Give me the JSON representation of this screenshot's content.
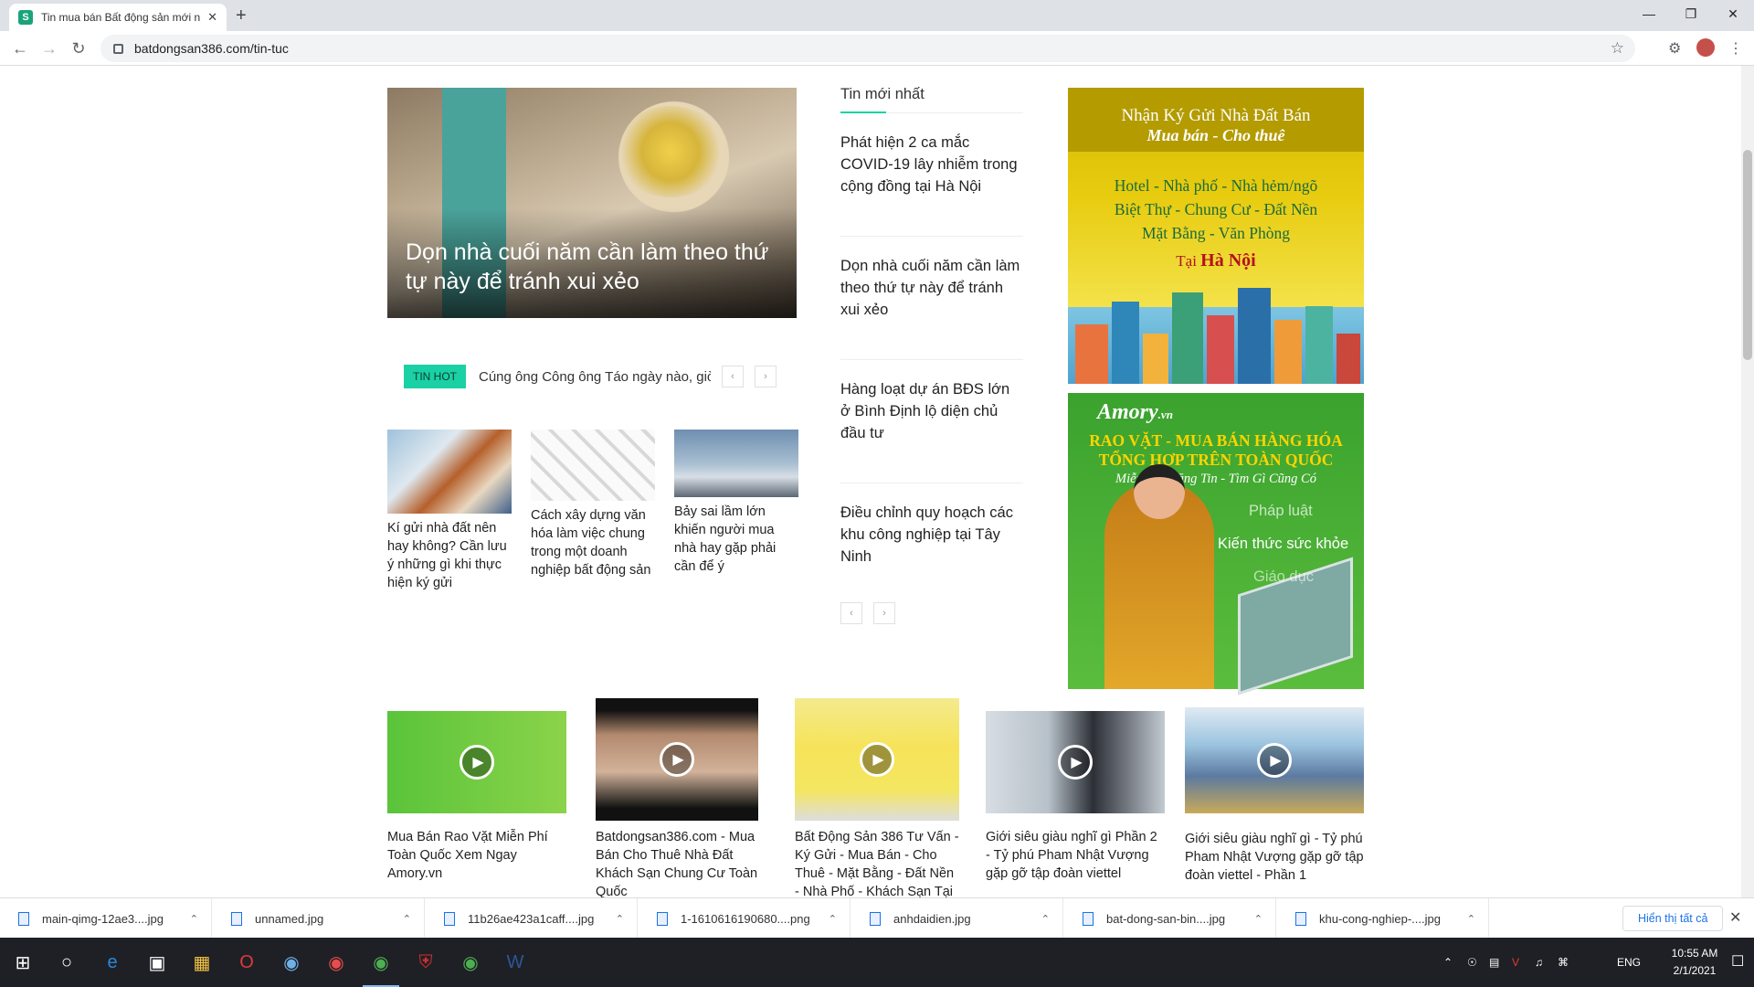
{
  "browser": {
    "tab_title": "Tin mua bán Bất động sản mới nhất",
    "url": "batdongsan386.com/tin-tuc",
    "new_tab": "+",
    "close_tab": "✕"
  },
  "hero": {
    "title": "Dọn nhà cuối năm cần làm theo thứ tự này để tránh xui xẻo"
  },
  "ticker": {
    "badge": "TIN HOT",
    "text": "Cúng ông Công ông Táo ngày nào, giờ nào tốt nhất"
  },
  "mini_articles": [
    {
      "caption": "Kí gửi nhà đất nên hay không? Cần lưu ý những gì khi thực hiện ký gửi"
    },
    {
      "caption": "Cách xây dựng văn hóa làm việc chung trong một doanh nghiệp bất động sản"
    },
    {
      "caption": "Bảy sai lầm lớn khiến người mua nhà hay gặp phải cần để ý"
    }
  ],
  "latest": {
    "heading": "Tin mới nhất",
    "items": [
      "Phát hiện 2 ca mắc COVID-19 lây nhiễm trong cộng đồng tại Hà Nội",
      "Dọn nhà cuối năm cần làm theo thứ tự này để tránh xui xẻo",
      "Hàng loạt dự án BĐS lớn ở Bình Định lộ diện chủ đầu tư",
      "Điều chỉnh quy hoạch các khu công nghiệp tại Tây Ninh"
    ]
  },
  "ad_kygui": {
    "line1": "Nhận Ký Gửi Nhà Đất Bán",
    "line2": "Mua bán - Cho thuê",
    "line3": "Hotel - Nhà phố - Nhà hẻm/ngõ",
    "line4": "Biệt Thự - Chung Cư - Đất Nền",
    "line5": "Mặt Bằng - Văn Phòng",
    "line6_prefix": "Tại",
    "line6_city": "Hà Nội"
  },
  "ad_amory": {
    "logo": "Amory",
    "logo_suffix": ".vn",
    "headline1": "RAO VẶT - MUA BÁN HÀNG HÓA",
    "headline2": "TỔNG HỢP TRÊN TOÀN QUỐC",
    "sub": "Miễn Phí Đăng Tin - Tìm Gì Cũng Có",
    "menu": [
      "Pháp luật",
      "Kiến thức sức khỏe",
      "Giáo dục"
    ]
  },
  "videos": [
    {
      "caption": "Mua Bán Rao Vặt Miễn Phí Toàn Quốc Xem Ngay Amory.vn"
    },
    {
      "caption": "Batdongsan386.com - Mua Bán Cho Thuê Nhà Đất Khách Sạn Chung Cư Toàn Quốc"
    },
    {
      "caption": "Bất Động Sản 386 Tư Vấn - Ký Gửi - Mua Bán - Cho Thuê - Mặt Bằng - Đất Nền - Nhà Phố - Khách Sạn Tại Hà Nội"
    },
    {
      "caption": "Giới siêu giàu nghĩ gì Phần 2 - Tỷ phú Pham Nhật Vượng gặp gỡ tập đoàn viettel"
    },
    {
      "caption": "Giới siêu giàu nghĩ gì - Tỷ phú Pham Nhật Vượng gặp gỡ tập đoàn viettel - Phần 1"
    }
  ],
  "downloads": {
    "files": [
      "main-qimg-12ae3....jpg",
      "unnamed.jpg",
      "11b26ae423a1caff....jpg",
      "1-1610616190680....png",
      "anhdaidien.jpg",
      "bat-dong-san-bin....jpg",
      "khu-cong-nghiep-....jpg"
    ],
    "show_all": "Hiển thị tất cả"
  },
  "taskbar": {
    "lang": "ENG",
    "time": "10:55 AM",
    "date": "2/1/2021"
  }
}
